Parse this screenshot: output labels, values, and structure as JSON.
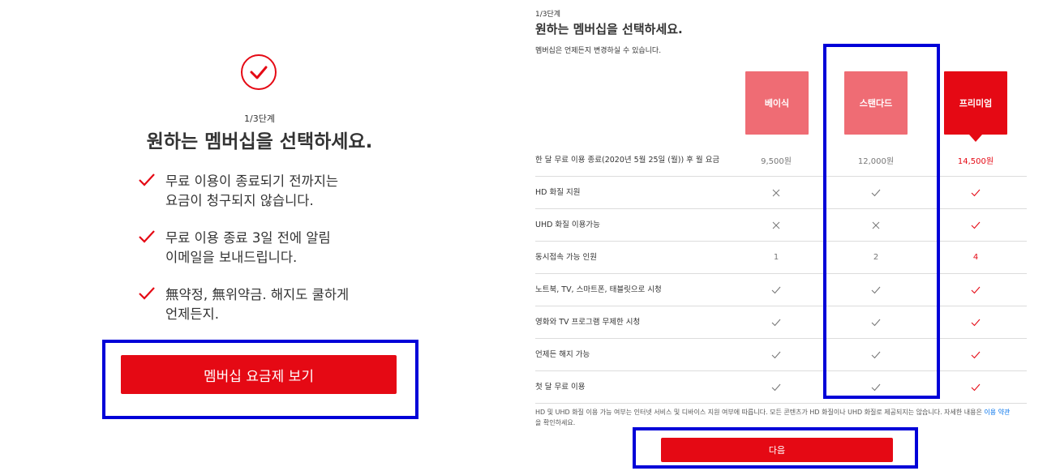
{
  "colors": {
    "brand_red": "#e50914",
    "plan_inactive": "#ef6c74",
    "highlight_blue": "#0000d8",
    "link_blue": "#0071eb"
  },
  "left": {
    "icon": "check-circle-icon",
    "step": "1/3단계",
    "title": "원하는 멤버십을 선택하세요.",
    "benefits": [
      "무료 이용이 종료되기 전까지는\n요금이 청구되지 않습니다.",
      "무료 이용 종료 3일 전에 알림\n이메일을 보내드립니다.",
      "無약정, 無위약금. 해지도 쿨하게\n언제든지."
    ],
    "cta_label": "멤버십 요금제 보기"
  },
  "right": {
    "step": "1/3단계",
    "title": "원하는 멤버십을 선택하세요.",
    "subtitle": "멤버십은 언제든지 변경하실 수 있습니다.",
    "plans": [
      "베이식",
      "스탠다드",
      "프리미엄"
    ],
    "selected_plan": "프리미엄",
    "rows": [
      {
        "label": "한 달 무료 이용 종료(2020년 5월 25일 (월)) 후 월 요금",
        "values": [
          "9,500원",
          "12,000원",
          "14,500원"
        ]
      },
      {
        "label": "HD 화질 지원",
        "values": [
          "cross",
          "check",
          "check"
        ]
      },
      {
        "label": "UHD 화질 이용가능",
        "values": [
          "cross",
          "cross",
          "check"
        ]
      },
      {
        "label": "동시접속 가능 인원",
        "values": [
          "1",
          "2",
          "4"
        ]
      },
      {
        "label": "노트북, TV, 스마트폰, 태블릿으로 시청",
        "values": [
          "check",
          "check",
          "check"
        ]
      },
      {
        "label": "영화와 TV 프로그램 무제한 시청",
        "values": [
          "check",
          "check",
          "check"
        ]
      },
      {
        "label": "언제든 해지 가능",
        "values": [
          "check",
          "check",
          "check"
        ]
      },
      {
        "label": "첫 달 무료 이용",
        "values": [
          "check",
          "check",
          "check"
        ]
      }
    ],
    "footnote_text": "HD 및 UHD 화질 이용 가능 여부는 인터넷 서비스 및 디바이스 지원 여부에 따릅니다. 모든 콘텐츠가 HD 화질이나 UHD 화질로 제공되지는 않습니다. 자세한 내용은 ",
    "footnote_link": "이용 약관",
    "footnote_end": "을 확인하세요.",
    "cta_label": "다음"
  }
}
